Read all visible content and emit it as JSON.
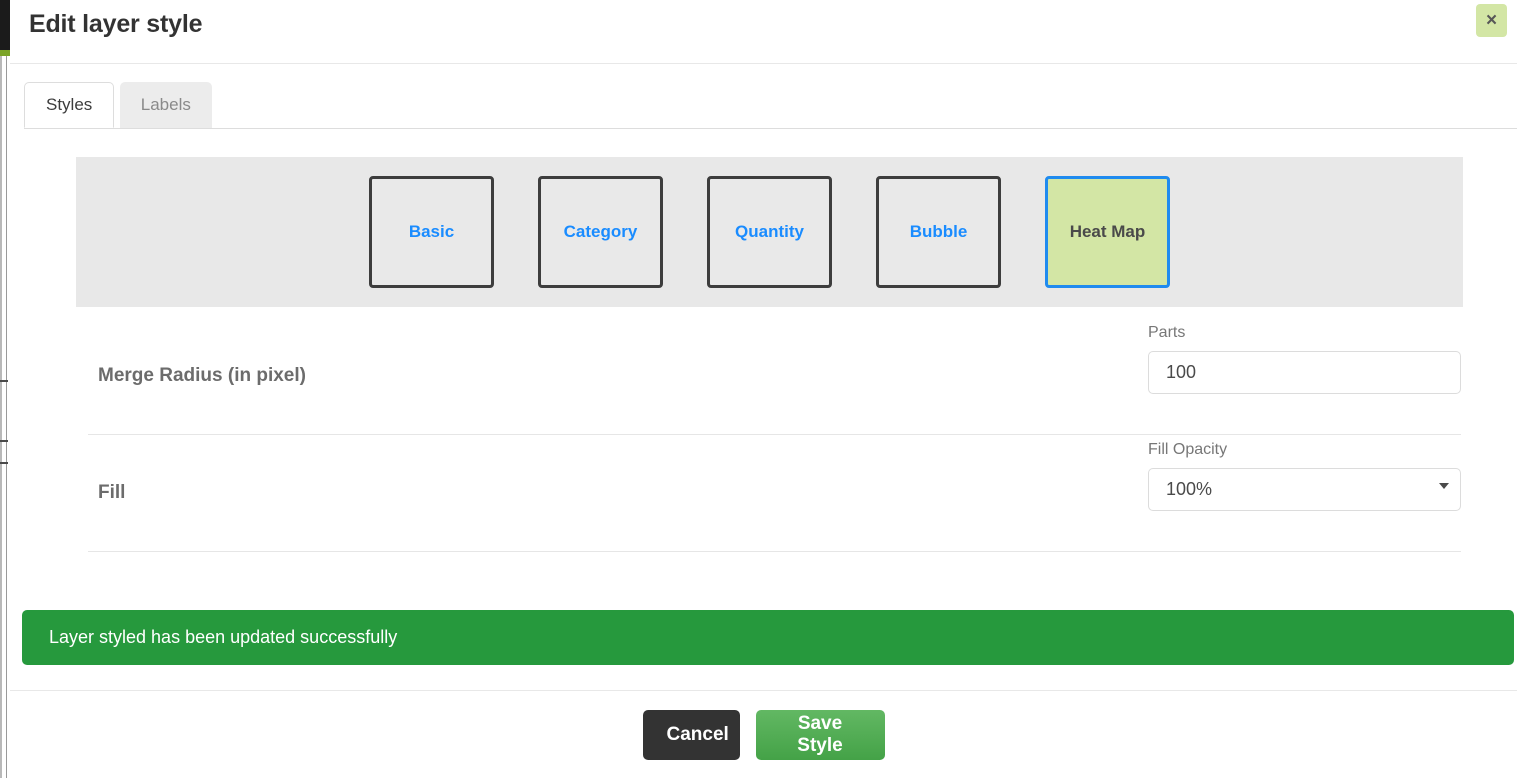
{
  "modal": {
    "title": "Edit layer style",
    "close_label": "×",
    "close_icon": "close-icon"
  },
  "tabs": [
    {
      "label": "Styles",
      "active": true
    },
    {
      "label": "Labels",
      "active": false
    }
  ],
  "style_types": [
    {
      "label": "Basic",
      "selected": false
    },
    {
      "label": "Category",
      "selected": false
    },
    {
      "label": "Quantity",
      "selected": false
    },
    {
      "label": "Bubble",
      "selected": false
    },
    {
      "label": "Heat Map",
      "selected": true
    }
  ],
  "form": {
    "rows": [
      {
        "label": "Merge Radius (in pixel)",
        "field_caption": "Parts",
        "field_type": "text",
        "value": "100",
        "placeholder": "Parts"
      },
      {
        "label": "Fill",
        "field_caption": "Fill Opacity",
        "field_type": "select",
        "value": "100%",
        "caret_icon": "chevron-down-icon"
      }
    ]
  },
  "alert": {
    "message": "Layer styled has been updated successfully",
    "type": "success",
    "color": "#26993d"
  },
  "footer": {
    "cancel_label": "Cancel",
    "save_label": "Save Style"
  },
  "colors": {
    "accent_blue": "#1a8cff",
    "selected_border": "#1f8bef",
    "selected_fill": "#d3e6a5",
    "success_green": "#26993d",
    "save_green": "#44a247",
    "panel_gray": "#e8e8e8"
  }
}
